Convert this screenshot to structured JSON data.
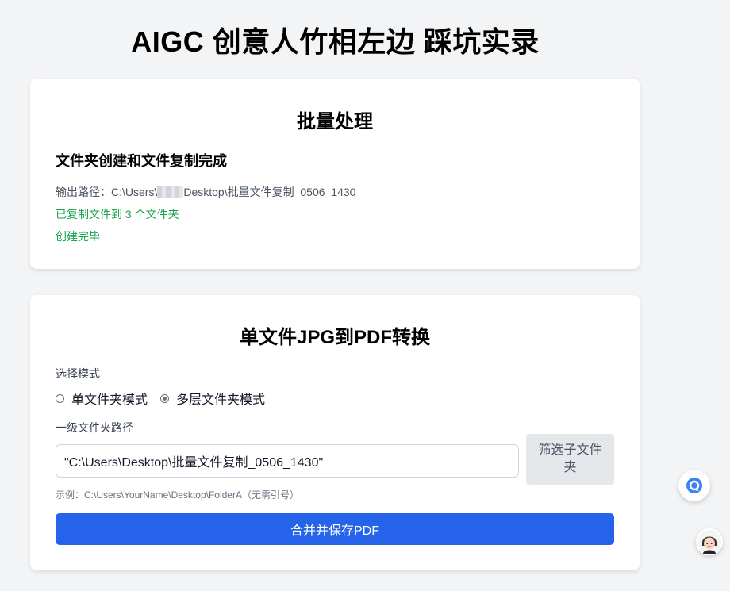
{
  "page": {
    "title": "AIGC 创意人竹相左边 踩坑实录"
  },
  "batch": {
    "title": "批量处理",
    "status_heading": "文件夹创建和文件复制完成",
    "output_label": "输出路径：",
    "output_path_prefix": "C:\\Users\\",
    "output_path_suffix": "Desktop\\批量文件复制_0506_1430",
    "copied_text": "已复制文件到 3 个文件夹",
    "done_text": "创建完毕"
  },
  "convert": {
    "title": "单文件JPG到PDF转换",
    "mode_label": "选择模式",
    "modes": [
      {
        "label": "单文件夹模式",
        "checked": false
      },
      {
        "label": "多层文件夹模式",
        "checked": true
      }
    ],
    "path_label": "一级文件夹路径",
    "path_value": "\"C:\\Users\\Desktop\\批量文件复制_0506_1430\"",
    "filter_button": "筛选子文件夹",
    "example": "示例：C:\\Users\\YourName\\Desktop\\FolderA（无需引号）",
    "merge_button": "合并并保存PDF"
  },
  "colors": {
    "accent": "#2563eb",
    "success": "#16a34a",
    "background": "#f3f4f6"
  },
  "icons": {
    "floating": "chat-assistant-icon",
    "avatar": "user-avatar"
  }
}
